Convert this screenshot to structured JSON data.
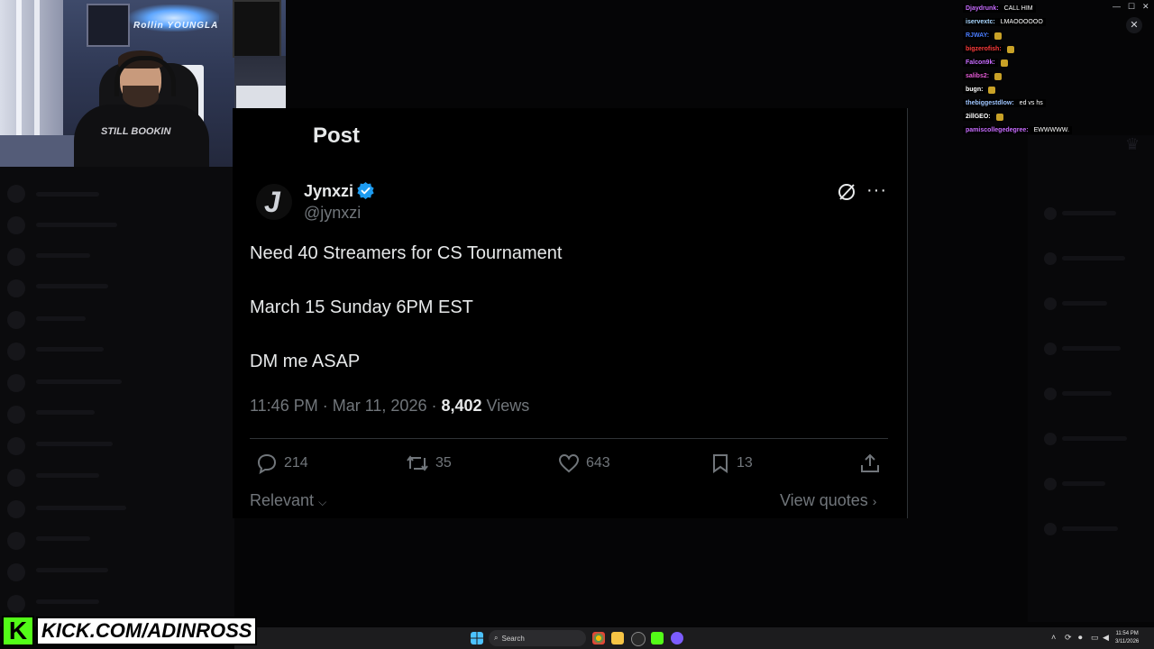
{
  "post": {
    "header_title": "Post",
    "author_name": "Jynxzi",
    "author_handle": "@jynxzi",
    "text_line1": "Need 40 Streamers for CS Tournament",
    "text_line2": "March 15 Sunday 6PM EST",
    "text_line3": "DM me ASAP",
    "time": "11:46 PM",
    "date": "Mar 11, 2026",
    "views_count": "8,402",
    "views_label": "Views",
    "replies": "214",
    "reposts": "35",
    "likes": "643",
    "bookmarks": "13",
    "relevant_label": "Relevant",
    "view_quotes_label": "View quotes"
  },
  "chat": [
    {
      "user": "Djaydrunk:",
      "msg": "CALL HIM",
      "color": "#c86cff"
    },
    {
      "user": "iservextc:",
      "msg": "LMAOOOOOO",
      "color": "#a9d7ff"
    },
    {
      "user": "RJWAY:",
      "msg": "",
      "color": "#4a7dff",
      "emote": true
    },
    {
      "user": "bigzerofish:",
      "msg": "",
      "color": "#ff3b3b",
      "emote": true
    },
    {
      "user": "Falcon9k:",
      "msg": "",
      "color": "#c86cff",
      "emote": true
    },
    {
      "user": "salibs2:",
      "msg": "",
      "color": "#e55bd6",
      "emote": true
    },
    {
      "user": "bugn:",
      "msg": "",
      "color": "#ffffff",
      "emote": true
    },
    {
      "user": "thebiggestdlow:",
      "msg": "ed vs hs",
      "color": "#9ec5ff"
    },
    {
      "user": "2illGEO:",
      "msg": "",
      "color": "#ffffff",
      "emote": true
    },
    {
      "user": "pamiscollegedegree:",
      "msg": "EWWWWW.",
      "color": "#c86cff"
    }
  ],
  "branding": {
    "logo_letter": "K",
    "url": "KICK.COM/ADINROSS"
  },
  "webcam": {
    "neon_sign": "Rollin YOUNGLA",
    "shirt_text": "STILL BOOKIN"
  },
  "taskbar": {
    "search_label": "Search",
    "clock_time": "11:54 PM",
    "clock_date": "3/11/2026"
  },
  "icons": [
    "verified-badge-icon",
    "grok-icon",
    "more-icon",
    "reply-icon",
    "repost-icon",
    "like-icon",
    "bookmark-icon",
    "share-icon",
    "chevron-down-icon",
    "chevron-right-icon",
    "close-icon",
    "windows-start-icon",
    "search-icon"
  ]
}
